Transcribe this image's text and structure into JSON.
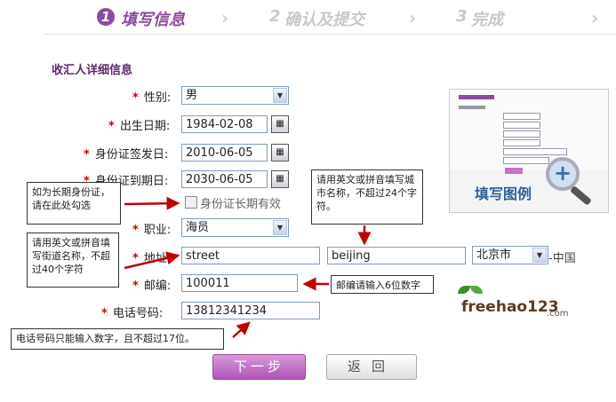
{
  "steps": [
    {
      "num": "1",
      "label": "填写信息"
    },
    {
      "num": "2",
      "label": "确认及提交"
    },
    {
      "num": "3",
      "label": "完成"
    }
  ],
  "section_title": "收汇人详细信息",
  "fields": {
    "gender": {
      "label": "性别:",
      "value": "男"
    },
    "birth_date": {
      "label": "出生日期:",
      "value": "1984-02-08"
    },
    "id_issue_date": {
      "label": "身份证签发日:",
      "value": "2010-06-05"
    },
    "id_expiry_date": {
      "label": "身份证到期日:",
      "value": "2030-06-05"
    },
    "long_term_checkbox": {
      "label": "身份证长期有效"
    },
    "occupation": {
      "label": "职业:",
      "value": "海员"
    },
    "address": {
      "label": "地址:",
      "street": "street",
      "city_input": "beijing",
      "city_select": "北京市",
      "country": "中国"
    },
    "postcode": {
      "label": "邮编:",
      "value": "100011"
    },
    "phone": {
      "label": "电话号码:",
      "value": "13812341234"
    }
  },
  "tips": {
    "long_term": "如为长期身份证，请在此处勾选",
    "street": "请用英文或拼音填写街道名称，不超过40个字符",
    "city": "请用英文或拼音填写城市名称，不超过24个字符。",
    "postcode": "邮编请输入6位数字",
    "phone": "电话号码只能输入数字，且不超过17位。"
  },
  "example": {
    "title": "填写图例"
  },
  "logo": {
    "text": "freehao123",
    "suffix": ".com"
  },
  "buttons": {
    "next": "下一步",
    "back": "返回"
  },
  "colors": {
    "brand": "#8c4a9e",
    "arrow": "#c00000",
    "star": "#cc0000"
  }
}
